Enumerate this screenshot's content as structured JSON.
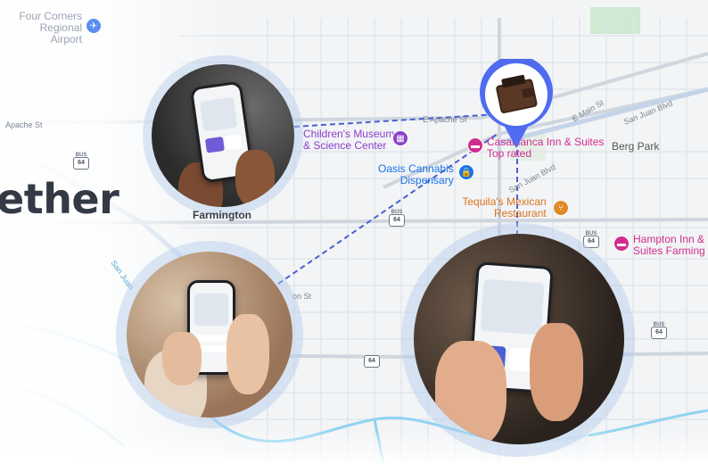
{
  "headline": "ether",
  "map_labels": {
    "airport": "Four Corners Regional Airport",
    "childrens_museum": "Children's Museum & Science Center",
    "childrens_museum_line1": "Children's Museum",
    "childrens_museum_line2": "& Science Center",
    "casablanca": "Casablanca Inn & Suites",
    "casablanca_sub": "Top rated",
    "oasis_line1": "Oasis Cannabis",
    "oasis_line2": "Dispensary",
    "tequilas_line1": "Tequila's Mexican",
    "tequilas_line2": "Restaurant",
    "hampton_line1": "Hampton Inn &",
    "hampton_line2": "Suites Farming",
    "berg_park": "Berg Park",
    "farmington": "Farmington",
    "e_apache_st": "E Apache St",
    "apache_st_left": "Apache St",
    "e_main_st": "E Main St",
    "san_juan_blvd": "San Juan Blvd",
    "san_juan_blvd_2": "San Juan Blvd",
    "san_juan_river": "San Juan",
    "broadway_st": "on St"
  },
  "route_badges": [
    {
      "label": "BUS",
      "number": "64"
    },
    {
      "label": "BUS",
      "number": "64"
    },
    {
      "label": "BUS",
      "number": "64"
    },
    {
      "label": "",
      "number": "64"
    },
    {
      "label": "BUS",
      "number": "64"
    }
  ],
  "icons": {
    "airport": "airplane-icon",
    "museum": "museum-icon",
    "hotel": "bed-icon",
    "dispensary": "lock-bag-icon",
    "restaurant": "fork-knife-icon",
    "wallet_pin": "wallet-pin-icon"
  },
  "colors": {
    "route_dashes": "#4a5fd1",
    "pin_blue": "#4f6bf0",
    "poi_purple": "#8a3fc9",
    "poi_pink": "#d12d8e",
    "poi_blue": "#1a73e8",
    "poi_orange": "#e08a2b",
    "water": "#8fd3f0"
  }
}
